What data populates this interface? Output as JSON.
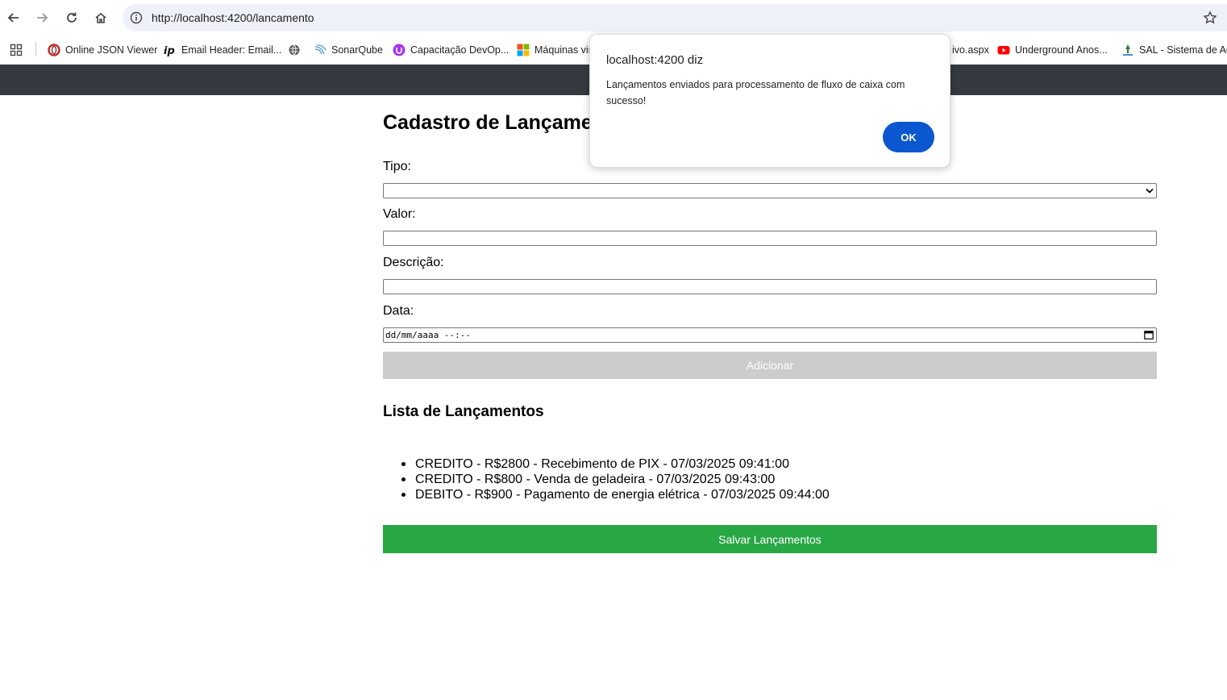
{
  "browser": {
    "url": "http://localhost:4200/lancamento",
    "bookmarks": [
      {
        "label": "Online JSON Viewer",
        "icon": "opera-icon"
      },
      {
        "label": "Email Header: Email...",
        "icon": "ip-icon"
      },
      {
        "label": "",
        "icon": "globe-icon"
      },
      {
        "label": "SonarQube",
        "icon": "sonarqube-icon"
      },
      {
        "label": "Capacitação DevOp...",
        "icon": "udemy-icon"
      },
      {
        "label": "Máquinas vir",
        "icon": "microsoft-icon"
      },
      {
        "label": "ivo.aspx",
        "icon": ""
      },
      {
        "label": "Underground Anos...",
        "icon": "youtube-icon"
      },
      {
        "label": "SAL - Sistema de Ac...",
        "icon": "sal-icon"
      }
    ]
  },
  "form": {
    "title": "Cadastro de Lançament",
    "tipo_label": "Tipo:",
    "tipo_value": "",
    "valor_label": "Valor:",
    "valor_value": "",
    "descricao_label": "Descrição:",
    "descricao_value": "",
    "data_label": "Data:",
    "data_placeholder": "dd/mm/aaaa --:--",
    "add_button": "Adicionar"
  },
  "list": {
    "title": "Lista de Lançamentos",
    "items": [
      "CREDITO - R$2800 - Recebimento de PIX - 07/03/2025 09:41:00",
      "CREDITO - R$800 - Venda de geladeira - 07/03/2025 09:43:00",
      "DEBITO - R$900 - Pagamento de energia elétrica - 07/03/2025 09:44:00"
    ],
    "save_button": "Salvar Lançamentos"
  },
  "dialog": {
    "title": "localhost:4200 diz",
    "message": "Lançamentos enviados para processamento de fluxo de caixa com sucesso!",
    "ok_button": "OK"
  },
  "colors": {
    "appbar": "#343a40",
    "save_button": "#28a745",
    "add_button_disabled": "#cccccc",
    "dialog_ok": "#0b57d0"
  }
}
